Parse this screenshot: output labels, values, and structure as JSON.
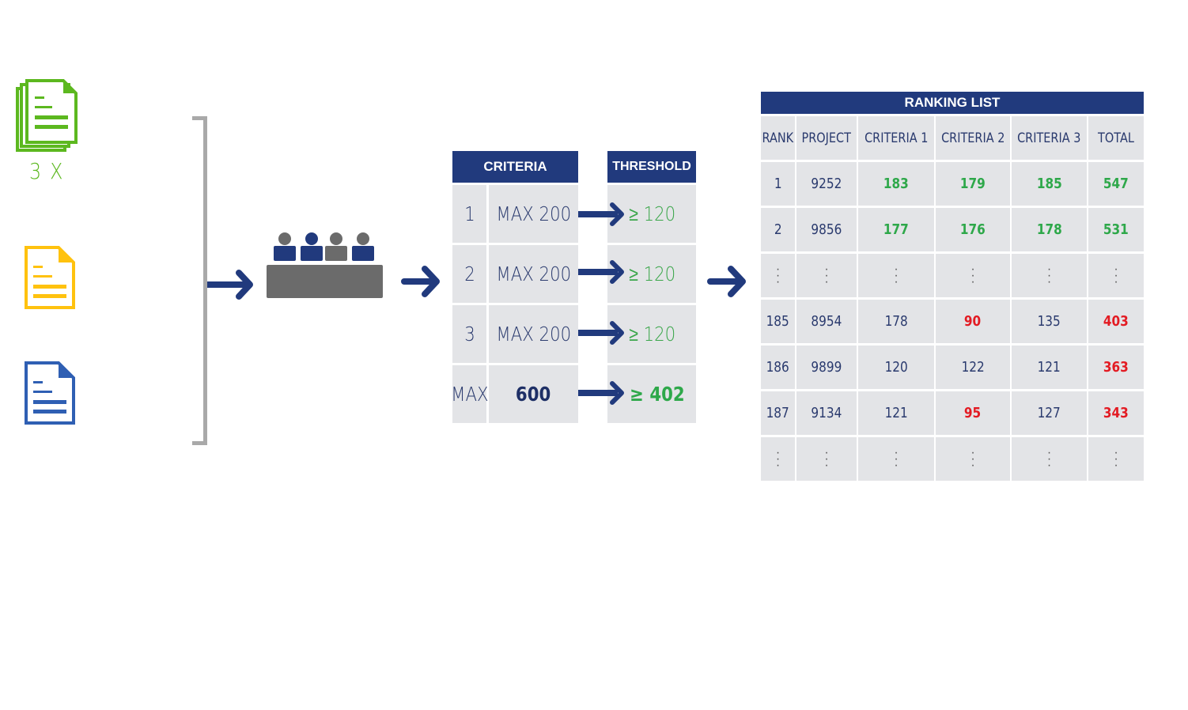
{
  "inputs": {
    "documents": [
      {
        "name": "green-document-stack",
        "color": "#5cb81f",
        "multiplier_label": "3 X"
      },
      {
        "name": "yellow-document",
        "color": "#ffc20e"
      },
      {
        "name": "blue-document",
        "color": "#2f5fb3"
      }
    ]
  },
  "colors": {
    "navy": "#213a7d",
    "cell_bg": "#e3e4e7",
    "pass_green": "#2ea84a",
    "fail_red": "#e31b23",
    "bracket_gray": "#a9a9a9",
    "table_gray": "#6b6b6b"
  },
  "criteria": {
    "header": "CRITERIA",
    "rows": [
      {
        "index": "1",
        "value": "MAX 200"
      },
      {
        "index": "2",
        "value": "MAX 200"
      },
      {
        "index": "3",
        "value": "MAX 200"
      },
      {
        "index": "MAX",
        "value": "600"
      }
    ]
  },
  "threshold": {
    "header": "THRESHOLD",
    "rows": [
      "≥ 120",
      "≥ 120",
      "≥ 120",
      "≥ 402"
    ]
  },
  "ranking": {
    "title": "RANKING LIST",
    "columns": [
      "RANK",
      "PROJECT",
      "CRITERIA 1",
      "CRITERIA 2",
      "CRITERIA 3",
      "TOTAL"
    ],
    "rows": [
      {
        "cells": [
          "1",
          "9252",
          "183",
          "179",
          "185",
          "547"
        ],
        "styles": [
          "n",
          "n",
          "g",
          "g",
          "g",
          "g"
        ]
      },
      {
        "cells": [
          "2",
          "9856",
          "177",
          "176",
          "178",
          "531"
        ],
        "styles": [
          "n",
          "n",
          "g",
          "g",
          "g",
          "g"
        ]
      },
      {
        "cells": [
          "⋮",
          "⋮",
          "⋮",
          "⋮",
          "⋮",
          "⋮"
        ],
        "styles": [
          "d",
          "d",
          "d",
          "d",
          "d",
          "d"
        ]
      },
      {
        "cells": [
          "185",
          "8954",
          "178",
          "90",
          "135",
          "403"
        ],
        "styles": [
          "n",
          "n",
          "n",
          "r",
          "n",
          "r"
        ]
      },
      {
        "cells": [
          "186",
          "9899",
          "120",
          "122",
          "121",
          "363"
        ],
        "styles": [
          "n",
          "n",
          "n",
          "n",
          "n",
          "r"
        ]
      },
      {
        "cells": [
          "187",
          "9134",
          "121",
          "95",
          "127",
          "343"
        ],
        "styles": [
          "n",
          "n",
          "n",
          "r",
          "n",
          "r"
        ]
      },
      {
        "cells": [
          "⋮",
          "⋮",
          "⋮",
          "⋮",
          "⋮",
          "⋮"
        ],
        "styles": [
          "d",
          "d",
          "d",
          "d",
          "d",
          "d"
        ]
      }
    ]
  }
}
